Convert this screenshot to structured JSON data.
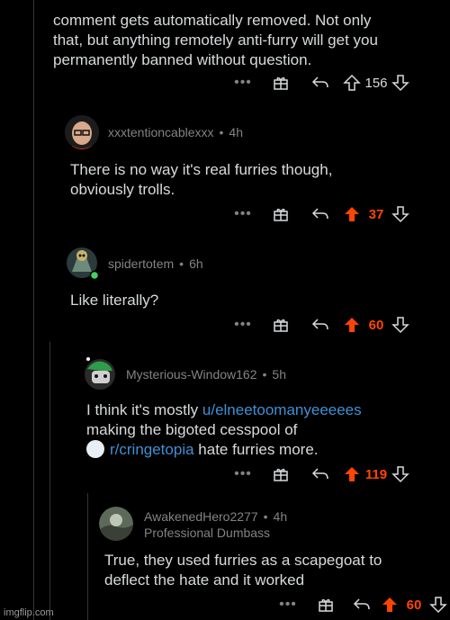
{
  "top_comment": {
    "lines": [
      "comment gets automatically removed. Not only",
      "that, but anything remotely anti-furry will get you",
      "permanently banned without question."
    ],
    "score": "156"
  },
  "comments": [
    {
      "username": "xxxtentioncablexxx",
      "time": "4h",
      "lines": [
        "There is no way it's real furries though,",
        "obviously trolls."
      ],
      "score": "37"
    },
    {
      "username": "spidertotem",
      "time": "6h",
      "lines": [
        "Like literally?"
      ],
      "score": "60"
    },
    {
      "username": "Mysterious-Window162",
      "time": "5h",
      "line1_pre": "I think it's mostly ",
      "line1_link": "u/elneetoomanyeeeees",
      "line2": "making the bigoted cesspool of",
      "line3_link": "r/cringetopia",
      "line3_post": " hate furries more.",
      "score": "119"
    },
    {
      "username": "AwakenedHero2277",
      "time": "4h",
      "flair": "Professional Dumbass",
      "lines": [
        "True, they used furries as a scapegoat to",
        "deflect the hate and it worked"
      ],
      "score": "60"
    }
  ],
  "separator": "•",
  "more_label": "•••",
  "watermark": "imgflip.com",
  "colors": {
    "upvoted": "#ff4500",
    "text": "#d7dadc",
    "meta": "#818384",
    "link": "#3f8fd6"
  }
}
